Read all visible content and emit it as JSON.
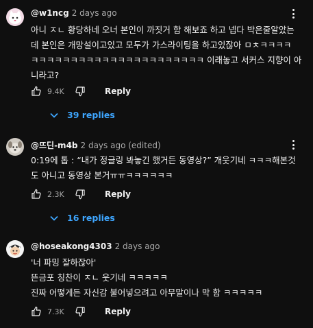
{
  "comments": [
    {
      "author": "@w1ncg",
      "time": "2 days ago",
      "lines": [
        "아니 ㅈㄴ 황당하네 오너 본인이 까짓거 함 해보죠 하고 넵다 박은줄알았는",
        "데 본인은 개망설이고있고 모두가 가스라이팅을 하고있잖아 ㅁㅊㅋㅋㅋㅋ",
        "ㅋㅋㅋㅋㅋㅋㅋㅋㅋㅋㅋㅋㅋㅋㅋㅋㅋㅋㅋㅋㅋㅋ 이래놓고 서커스 지향이 아",
        "니라고?"
      ],
      "likes": "9.4K",
      "reply_label": "Reply",
      "replies_label": "39 replies"
    },
    {
      "author": "@뜨딘-m4b",
      "time": "2 days ago (edited)",
      "lines": [
        "0:19에 톱 : “내가 정글링 봐놓긴 했거든 동영상?” 개웃기네 ㅋㅋㅋ해본것",
        "도 아니고 동영상 본거ㅠㅠㅋㅋㅋㅋㅋㅋ"
      ],
      "likes": "2.3K",
      "reply_label": "Reply",
      "replies_label": "16 replies"
    },
    {
      "author": "@hoseakong4303",
      "time": "2 days ago",
      "lines": [
        "'너 파밍 잘하잖아'",
        "뜬금포 칭찬이 ㅈㄴ 웃기네 ㅋㅋㅋㅋㅋ",
        "진짜 어떻게든 자신감 불어넣으려고 아무말이나 막 함 ㅋㅋㅋㅋㅋ"
      ],
      "likes": "7.3K",
      "reply_label": "Reply"
    }
  ],
  "colors": {
    "background": "#0f0f0f",
    "text": "#f1f1f1",
    "secondary": "#aaaaaa",
    "link": "#3ea6ff"
  }
}
